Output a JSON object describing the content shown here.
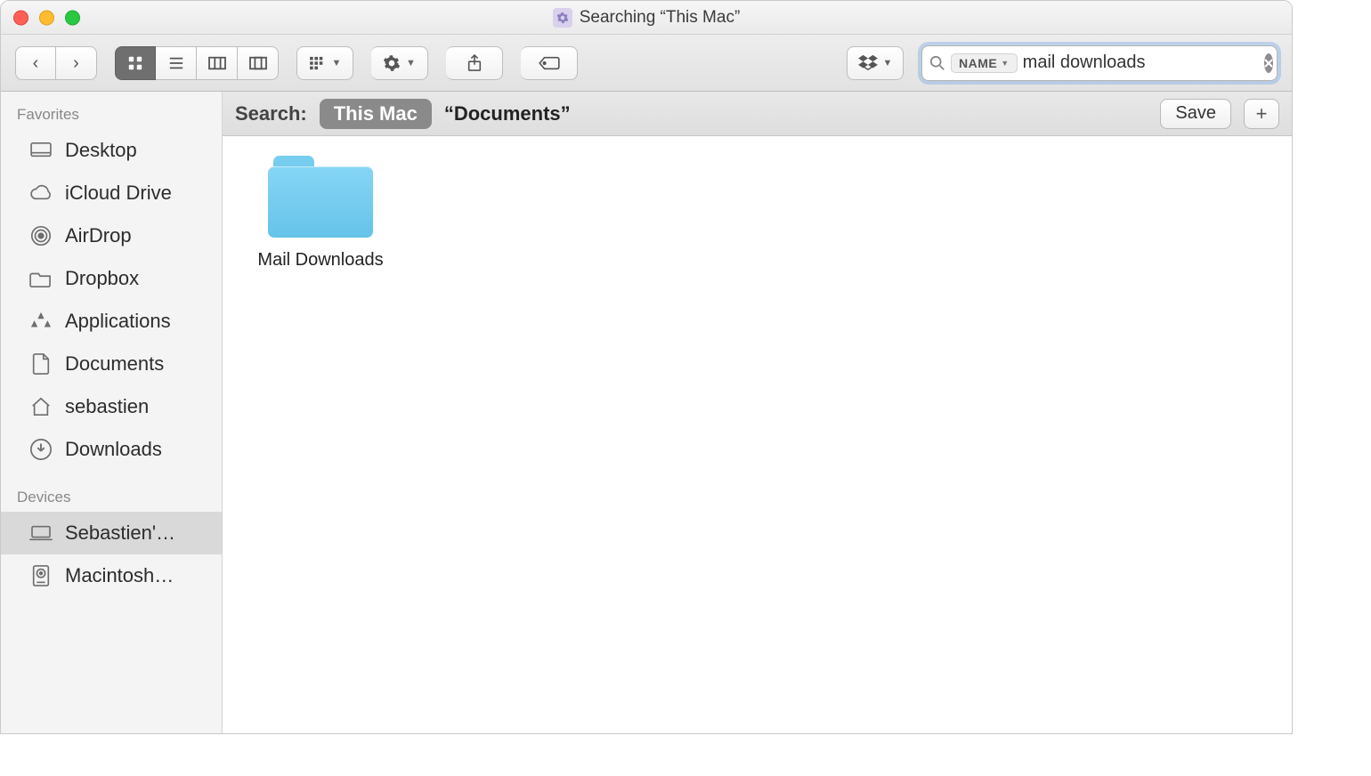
{
  "titlebar": {
    "title": "Searching “This Mac”"
  },
  "search": {
    "scope_label": "NAME",
    "value": "mail downloads"
  },
  "sidebar": {
    "sections": [
      {
        "title": "Favorites",
        "items": [
          {
            "icon": "desktop-icon",
            "label": "Desktop"
          },
          {
            "icon": "cloud-icon",
            "label": "iCloud Drive"
          },
          {
            "icon": "airdrop-icon",
            "label": "AirDrop"
          },
          {
            "icon": "folder-icon",
            "label": "Dropbox"
          },
          {
            "icon": "apps-icon",
            "label": "Applications"
          },
          {
            "icon": "documents-icon",
            "label": "Documents"
          },
          {
            "icon": "home-icon",
            "label": "sebastien"
          },
          {
            "icon": "download-icon",
            "label": "Downloads"
          }
        ]
      },
      {
        "title": "Devices",
        "items": [
          {
            "icon": "laptop-icon",
            "label": "Sebastien'…",
            "selected": true
          },
          {
            "icon": "hdd-icon",
            "label": "Macintosh…"
          }
        ]
      }
    ]
  },
  "searchbar": {
    "label": "Search:",
    "scope_active": "This Mac",
    "scope_other": "“Documents”",
    "save_label": "Save"
  },
  "results": [
    {
      "name": "Mail Downloads",
      "type": "folder"
    }
  ]
}
